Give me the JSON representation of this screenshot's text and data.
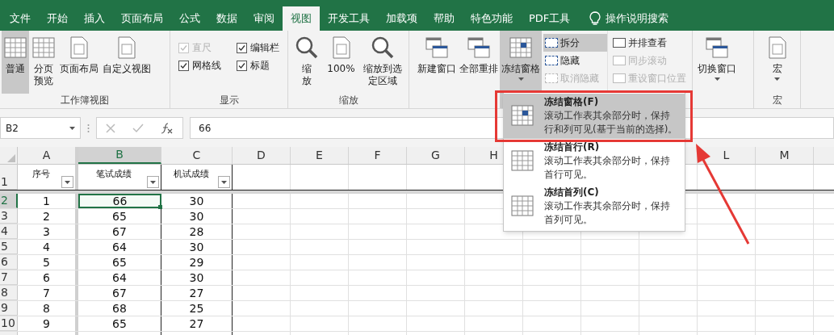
{
  "tabs": [
    {
      "label": "文件",
      "selected": false
    },
    {
      "label": "开始",
      "selected": false
    },
    {
      "label": "插入",
      "selected": false
    },
    {
      "label": "页面布局",
      "selected": false
    },
    {
      "label": "公式",
      "selected": false
    },
    {
      "label": "数据",
      "selected": false
    },
    {
      "label": "审阅",
      "selected": false
    },
    {
      "label": "视图",
      "selected": true
    },
    {
      "label": "开发工具",
      "selected": false
    },
    {
      "label": "加载项",
      "selected": false
    },
    {
      "label": "帮助",
      "selected": false
    },
    {
      "label": "特色功能",
      "selected": false
    },
    {
      "label": "PDF工具",
      "selected": false
    }
  ],
  "tell_me": "操作说明搜索",
  "ribbon": {
    "workbook_views": {
      "label": "工作簿视图",
      "buttons": [
        {
          "label": "普通",
          "selected": true
        },
        {
          "label": "分页预览",
          "selected": false
        },
        {
          "label": "页面布局",
          "selected": false
        },
        {
          "label": "自定义视图",
          "selected": false
        }
      ]
    },
    "show": {
      "label": "显示",
      "checks": [
        {
          "label": "直尺",
          "checked": true,
          "disabled": true
        },
        {
          "label": "编辑栏",
          "checked": true,
          "disabled": false
        },
        {
          "label": "网格线",
          "checked": true,
          "disabled": false
        },
        {
          "label": "标题",
          "checked": true,
          "disabled": false
        }
      ]
    },
    "zoom": {
      "label": "缩放",
      "buttons": [
        {
          "label": "缩放"
        },
        {
          "label": "100%"
        },
        {
          "label": "缩放到选定区域"
        }
      ]
    },
    "window": {
      "buttons": [
        {
          "label": "新建窗口",
          "pressed": false
        },
        {
          "label": "全部重排",
          "pressed": false
        },
        {
          "label": "冻结窗格",
          "pressed": true
        }
      ],
      "pane_items": [
        {
          "label": "拆分",
          "pressed": true,
          "disabled": false
        },
        {
          "label": "隐藏",
          "pressed": false,
          "disabled": false
        },
        {
          "label": "取消隐藏",
          "pressed": false,
          "disabled": true
        }
      ],
      "compare_items": [
        {
          "label": "并排查看",
          "disabled": false
        },
        {
          "label": "同步滚动",
          "disabled": true
        },
        {
          "label": "重设窗口位置",
          "disabled": true
        }
      ],
      "switch": "切换窗口"
    },
    "macros": {
      "button": "宏",
      "label": "宏"
    }
  },
  "formula_bar": {
    "name_box": "B2",
    "value": "66"
  },
  "sheet": {
    "columns": [
      {
        "letter": "A",
        "selected": false
      },
      {
        "letter": "B",
        "selected": true
      },
      {
        "letter": "C",
        "selected": false
      },
      {
        "letter": "D",
        "selected": false
      },
      {
        "letter": "E",
        "selected": false
      },
      {
        "letter": "F",
        "selected": false
      },
      {
        "letter": "G",
        "selected": false
      },
      {
        "letter": "H",
        "selected": false
      },
      {
        "letter": "L",
        "selected": false
      },
      {
        "letter": "M",
        "selected": false
      }
    ],
    "rows": [
      {
        "header": "1",
        "selected": false,
        "kind": "header",
        "cells": [
          {
            "text": "序号",
            "selected": false
          },
          {
            "text": "笔试成绩",
            "selected": false
          },
          {
            "text": "机试成绩",
            "selected": false
          }
        ]
      },
      {
        "header": "2",
        "selected": true,
        "kind": "data",
        "cells": [
          {
            "text": "1",
            "selected": false
          },
          {
            "text": "66",
            "selected": true
          },
          {
            "text": "30",
            "selected": false
          }
        ]
      },
      {
        "header": "3",
        "selected": false,
        "kind": "data",
        "cells": [
          {
            "text": "2",
            "selected": false
          },
          {
            "text": "65",
            "selected": false
          },
          {
            "text": "30",
            "selected": false
          }
        ]
      },
      {
        "header": "4",
        "selected": false,
        "kind": "data",
        "cells": [
          {
            "text": "3",
            "selected": false
          },
          {
            "text": "67",
            "selected": false
          },
          {
            "text": "28",
            "selected": false
          }
        ]
      },
      {
        "header": "5",
        "selected": false,
        "kind": "data",
        "cells": [
          {
            "text": "4",
            "selected": false
          },
          {
            "text": "64",
            "selected": false
          },
          {
            "text": "30",
            "selected": false
          }
        ]
      },
      {
        "header": "6",
        "selected": false,
        "kind": "data",
        "cells": [
          {
            "text": "5",
            "selected": false
          },
          {
            "text": "65",
            "selected": false
          },
          {
            "text": "29",
            "selected": false
          }
        ]
      },
      {
        "header": "7",
        "selected": false,
        "kind": "data",
        "cells": [
          {
            "text": "6",
            "selected": false
          },
          {
            "text": "64",
            "selected": false
          },
          {
            "text": "30",
            "selected": false
          }
        ]
      },
      {
        "header": "8",
        "selected": false,
        "kind": "data",
        "cells": [
          {
            "text": "7",
            "selected": false
          },
          {
            "text": "67",
            "selected": false
          },
          {
            "text": "27",
            "selected": false
          }
        ]
      },
      {
        "header": "9",
        "selected": false,
        "kind": "data",
        "cells": [
          {
            "text": "8",
            "selected": false
          },
          {
            "text": "68",
            "selected": false
          },
          {
            "text": "25",
            "selected": false
          }
        ]
      },
      {
        "header": "10",
        "selected": false,
        "kind": "data",
        "cells": [
          {
            "text": "9",
            "selected": false
          },
          {
            "text": "65",
            "selected": false
          },
          {
            "text": "27",
            "selected": false
          }
        ]
      }
    ]
  },
  "freeze_menu": {
    "items": [
      {
        "title": "冻结窗格(F)",
        "description": "滚动工作表其余部分时，保持行和列可见(基于当前的选择)。",
        "selected": true
      },
      {
        "title": "冻结首行(R)",
        "description": "滚动工作表其余部分时，保持首行可见。",
        "selected": false
      },
      {
        "title": "冻结首列(C)",
        "description": "滚动工作表其余部分时，保持首列可见。",
        "selected": false
      }
    ]
  }
}
